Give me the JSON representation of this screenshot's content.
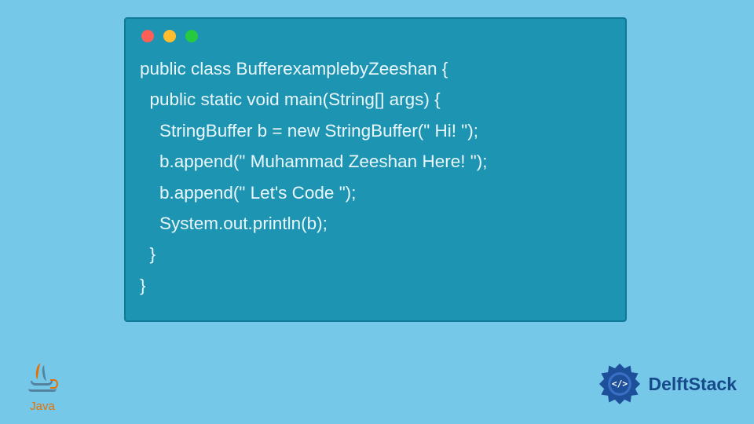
{
  "code": {
    "lines": [
      "public class BufferexamplebyZeeshan {",
      "  public static void main(String[] args) {",
      "    StringBuffer b = new StringBuffer(\" Hi! \");",
      "    b.append(\" Muhammad Zeeshan Here! \");",
      "    b.append(\" Let's Code \");",
      "    System.out.println(b);",
      "  }",
      "}"
    ]
  },
  "logos": {
    "java_label": "Java",
    "delftstack_label": "DelftStack"
  },
  "traffic": {
    "red": "close-dot",
    "yellow": "minimize-dot",
    "green": "zoom-dot"
  }
}
